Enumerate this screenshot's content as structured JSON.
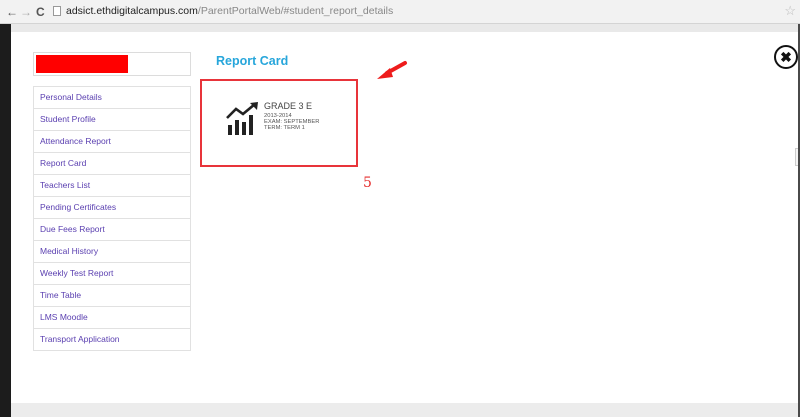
{
  "browser": {
    "back_icon": "arrow-left-icon",
    "forward_icon": "arrow-right-icon",
    "reload_icon": "reload-icon",
    "url_host": "adsict.ethdigitalcampus.com",
    "url_path": "/ParentPortalWeb/#student_report_details"
  },
  "page": {
    "title": "Report Card"
  },
  "sidebar": {
    "items": [
      {
        "label": "Personal Details"
      },
      {
        "label": "Student Profile"
      },
      {
        "label": "Attendance Report"
      },
      {
        "label": "Report Card"
      },
      {
        "label": "Teachers List"
      },
      {
        "label": "Pending Certificates"
      },
      {
        "label": "Due Fees Report"
      },
      {
        "label": "Medical History"
      },
      {
        "label": "Weekly Test Report"
      },
      {
        "label": "Time Table"
      },
      {
        "label": "LMS Moodle"
      },
      {
        "label": "Transport Application"
      }
    ]
  },
  "report_card": {
    "grade": "GRADE 3 E",
    "year": "2013-2014",
    "exam": "EXAM: SEPTEMBER",
    "term": "TERM: TERM 1",
    "icon": "growth-chart-icon"
  },
  "annotation": {
    "step_number": "5",
    "color": "#e53030"
  },
  "colors": {
    "title_blue": "#27a6db",
    "nav_link": "#5a3fb0",
    "highlight_red": "#e8343a"
  }
}
